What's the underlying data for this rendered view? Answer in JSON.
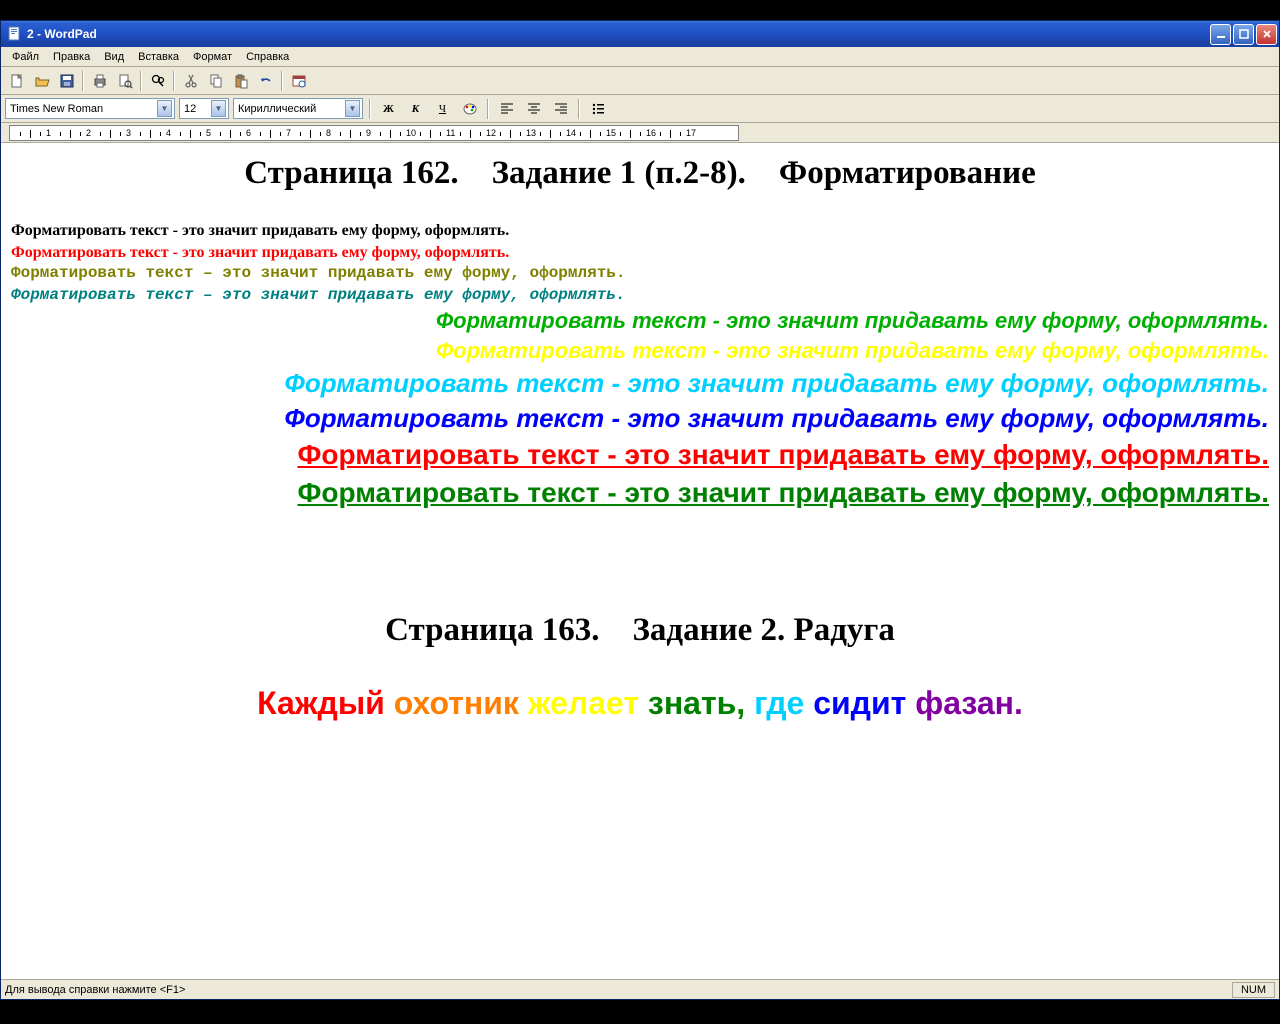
{
  "window": {
    "title": "2 - WordPad"
  },
  "menu": {
    "file": "Файл",
    "edit": "Правка",
    "view": "Вид",
    "insert": "Вставка",
    "format": "Формат",
    "help": "Справка"
  },
  "format": {
    "font": "Times New Roman",
    "size": "12",
    "script": "Кириллический",
    "bold": "Ж",
    "italic": "К",
    "underline": "Ч"
  },
  "doc": {
    "heading1": "Страница 162.    Задание 1 (п.2-8).    Форматирование",
    "line1": "Форматировать текст - это значит придавать ему форму, оформлять.",
    "line2": "Форматировать текст - это значит придавать ему форму, оформлять.",
    "line3": "Форматировать текст – это значит придавать ему форму, оформлять.",
    "line4": "Форматировать текст – это значит придавать ему форму, оформлять.",
    "line5": "Форматировать текст - это значит придавать ему форму, оформлять.",
    "line6": "Форматировать текст - это значит придавать ему форму, оформлять.",
    "line7": "Форматировать текст - это значит придавать ему форму, оформлять.",
    "line8": "Форматировать текст - это значит придавать ему форму, оформлять.",
    "line9": "Форматировать текст - это значит придавать ему форму, оформлять.",
    "line10": "Форматировать текст - это значит придавать ему форму, оформлять.",
    "heading2": "Страница 163.    Задание 2. Радуга",
    "rainbow": {
      "w1": "Каждый",
      "w2": "охотник",
      "w3": "желает",
      "w4": "знать,",
      "w5": "где",
      "w6": "сидит",
      "w7": "фазан."
    },
    "colors": {
      "black": "#000000",
      "red": "#ff0000",
      "olive": "#808000",
      "teal": "#008080",
      "green": "#00b000",
      "yellow": "#ffff00",
      "cyan": "#00d0ff",
      "blue": "#0000ff",
      "orange": "#ff8000",
      "darkgreen": "#008000",
      "violet": "#8000a0"
    }
  },
  "status": {
    "help": "Для вывода справки нажмите <F1>",
    "num": "NUM"
  },
  "ruler": {
    "marks": [
      "1",
      "2",
      "3",
      "4",
      "5",
      "6",
      "7",
      "8",
      "9",
      "10",
      "11",
      "12",
      "13",
      "14",
      "15",
      "16",
      "17"
    ]
  }
}
